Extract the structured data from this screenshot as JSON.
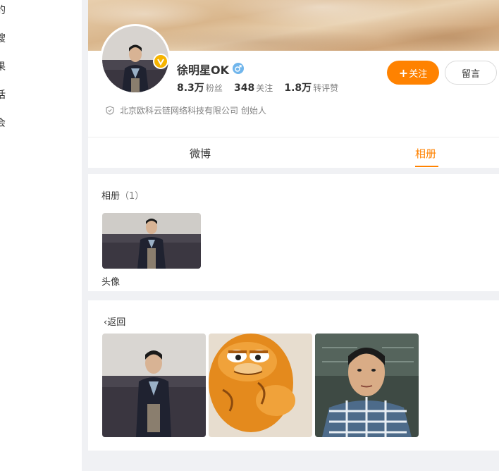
{
  "sidebar": {
    "items": [
      "的",
      "搜",
      "果",
      "话",
      "会"
    ]
  },
  "profile": {
    "name": "徐明星OK",
    "stats": [
      {
        "value": "8.3万",
        "label": "粉丝"
      },
      {
        "value": "348",
        "label": "关注"
      },
      {
        "value": "1.8万",
        "label": "转评赞"
      }
    ],
    "description": "北京欧科云链网络科技有限公司 创始人",
    "follow_label": "关注",
    "follow_plus": "+",
    "message_label": "留言"
  },
  "tabs": [
    {
      "label": "微博"
    },
    {
      "label": "相册"
    }
  ],
  "album_section": {
    "title": "相册",
    "count": "（1）",
    "albums": [
      {
        "name": "头像"
      }
    ]
  },
  "photos_section": {
    "back_label": "返回",
    "back_icon": "chevron-left-icon"
  },
  "colors": {
    "accent": "#ff8200",
    "verified": "#f6b400",
    "male": "#71b6ec"
  }
}
